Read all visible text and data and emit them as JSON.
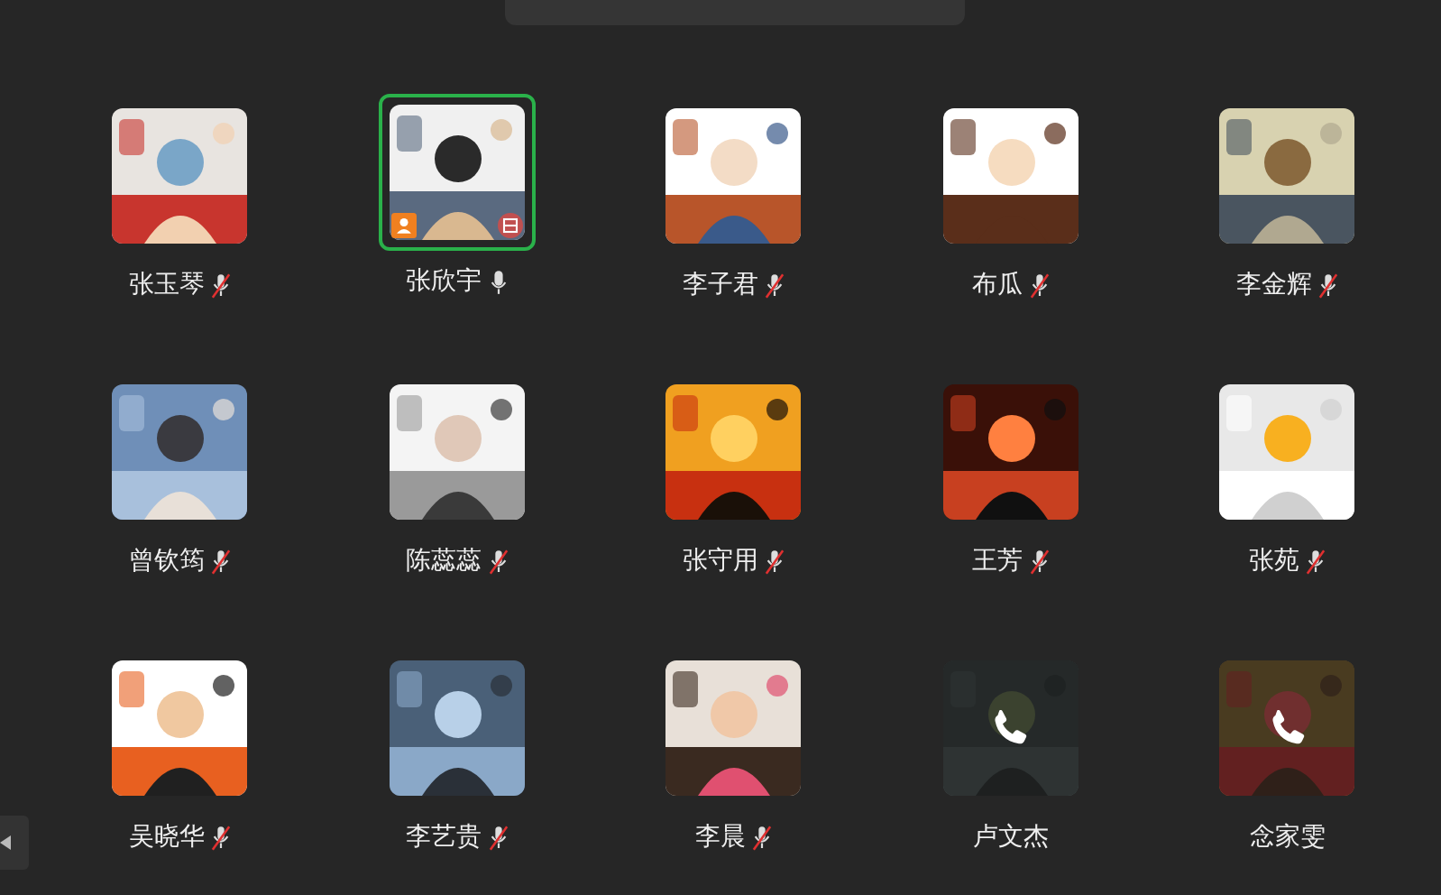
{
  "banner": {
    "kind": "notice"
  },
  "participants": [
    {
      "name": "张玉琴",
      "kind": "muted",
      "selected": false,
      "host": false
    },
    {
      "name": "张欣宇",
      "kind": "unmuted",
      "selected": true,
      "host": true
    },
    {
      "name": "李子君",
      "kind": "muted",
      "selected": false,
      "host": false
    },
    {
      "name": "布瓜",
      "kind": "muted",
      "selected": false,
      "host": false
    },
    {
      "name": "李金辉",
      "kind": "muted",
      "selected": false,
      "host": false
    },
    {
      "name": "曾钦筠",
      "kind": "muted",
      "selected": false,
      "host": false
    },
    {
      "name": "陈蕊蕊",
      "kind": "muted",
      "selected": false,
      "host": false
    },
    {
      "name": "张守用",
      "kind": "muted",
      "selected": false,
      "host": false
    },
    {
      "name": "王芳",
      "kind": "muted",
      "selected": false,
      "host": false
    },
    {
      "name": "张苑",
      "kind": "muted",
      "selected": false,
      "host": false
    },
    {
      "name": "吴晓华",
      "kind": "muted",
      "selected": false,
      "host": false
    },
    {
      "name": "李艺贵",
      "kind": "muted",
      "selected": false,
      "host": false
    },
    {
      "name": "李晨",
      "kind": "muted",
      "selected": false,
      "host": false
    },
    {
      "name": "卢文杰",
      "kind": "calling",
      "selected": false,
      "host": false
    },
    {
      "name": "念家雯",
      "kind": "calling",
      "selected": false,
      "host": false
    }
  ]
}
